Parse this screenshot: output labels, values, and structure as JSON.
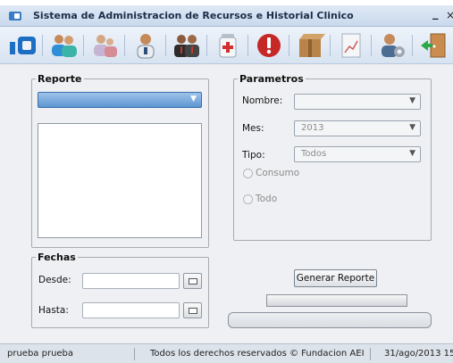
{
  "window": {
    "title": "Sistema de Administracion de Recursos e Historial Clinico",
    "minimize": "_",
    "close": "×"
  },
  "toolbar": {
    "icons": [
      "app-logo-icon",
      "users-icon",
      "patients-icon",
      "doctor-icon",
      "staff-icon",
      "medical-kit-icon",
      "alert-icon",
      "inventory-box-icon",
      "reports-chart-icon",
      "settings-user-icon",
      "exit-door-icon"
    ]
  },
  "reporte": {
    "legend": "Reporte",
    "selected": "",
    "list_items": []
  },
  "parametros": {
    "legend": "Parametros",
    "nombre_label": "Nombre:",
    "nombre_value": "",
    "mes_label": "Mes:",
    "mes_value": "2013",
    "tipo_label": "Tipo:",
    "tipo_value": "Todos",
    "consumo_label": "Consumo",
    "todo_label": "Todo"
  },
  "fechas": {
    "legend": "Fechas",
    "desde_label": "Desde:",
    "desde_value": "",
    "hasta_label": "Hasta:",
    "hasta_value": ""
  },
  "actions": {
    "generar_label": "Generar Reporte"
  },
  "status": {
    "user": "prueba prueba",
    "copyright": "Todos los derechos reservados © Fundacion AEI",
    "datetime": "31/ago/2013 15:"
  },
  "colors": {
    "accent": "#5d95d2",
    "titlebar": "#c9d9ec",
    "background": "#eef0f3"
  }
}
